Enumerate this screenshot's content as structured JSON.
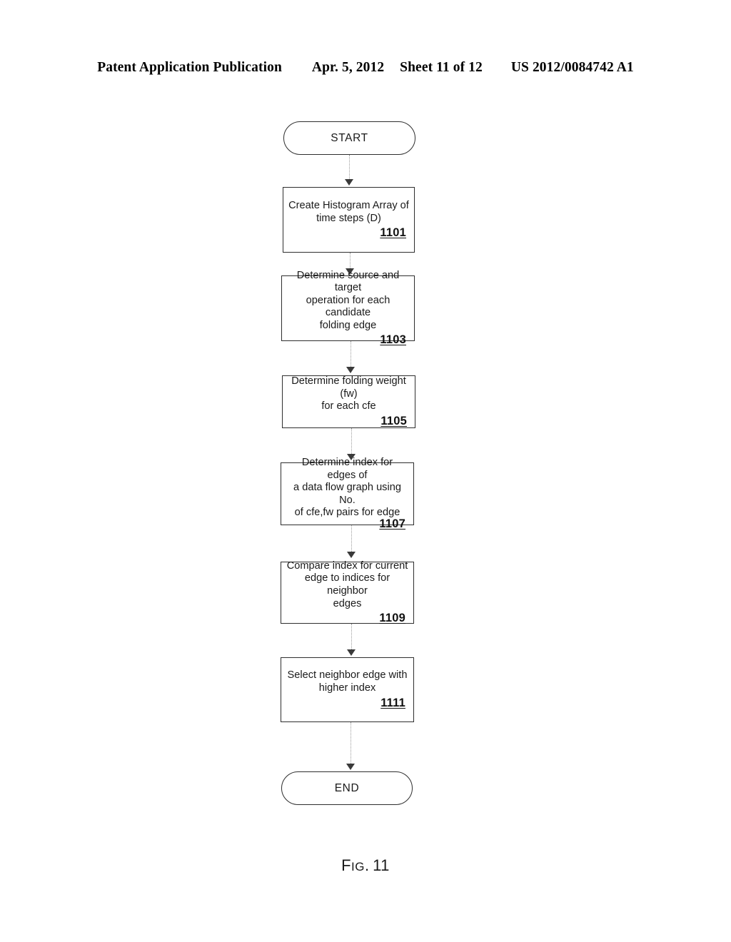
{
  "header": {
    "publication": "Patent Application Publication",
    "date": "Apr. 5, 2012",
    "sheet": "Sheet 11 of 12",
    "number": "US 2012/0084742 A1"
  },
  "figure": {
    "caption_prefix": "F",
    "caption_smallcaps": "IG",
    "caption_period": ".",
    "caption_number": "11"
  },
  "flowchart": {
    "start": {
      "label": "START"
    },
    "end": {
      "label": "END"
    },
    "steps": [
      {
        "text": "Create Histogram Array of\ntime steps (D)",
        "ref": "1101"
      },
      {
        "text": "Determine source and target\noperation for each candidate\nfolding edge",
        "ref": "1103"
      },
      {
        "text": "Determine folding weight (fw)\nfor each cfe",
        "ref": "1105"
      },
      {
        "text": "Determine index for edges of\na data flow graph using No.\nof cfe,fw pairs for edge",
        "ref": "1107"
      },
      {
        "text": "Compare index for current\nedge to indices for neighbor\nedges",
        "ref": "1109"
      },
      {
        "text": "Select neighbor edge with\nhigher index",
        "ref": "1111"
      }
    ]
  },
  "colors": {
    "ink": "#1a1a1a",
    "stroke": "#2e2e2e",
    "connector": "#9a9a9a",
    "page": "#ffffff"
  }
}
